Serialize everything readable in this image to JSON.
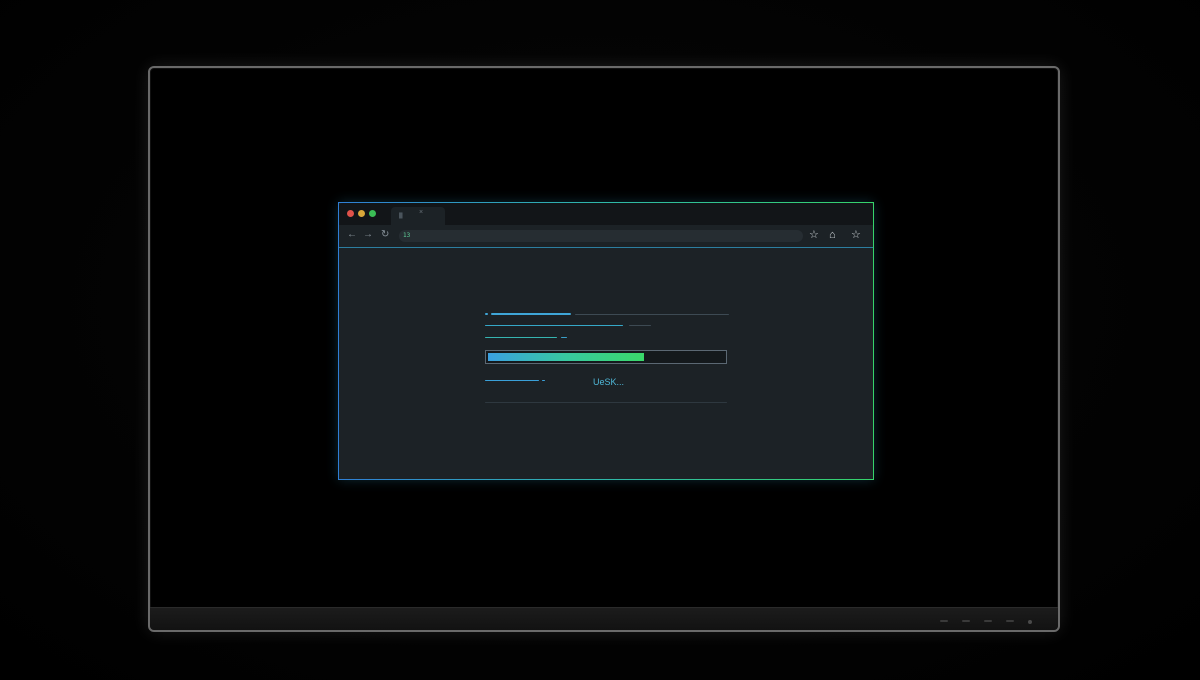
{
  "browser": {
    "tab_label": "█",
    "tab_close": "×",
    "address_badge": "13",
    "nav": {
      "back_icon": "←",
      "forward_icon": "→",
      "reload_icon": "↻"
    },
    "toolbar_right": {
      "star_icon": "☆",
      "extension_icon": "⌂",
      "profile_icon": "☆"
    }
  },
  "loader": {
    "progress": 0.66,
    "status_text": "UeSK..."
  },
  "colors": {
    "accent_blue": "#3aa0e0",
    "accent_green": "#3ad86a",
    "border_blue": "#2f7fd6",
    "border_green": "#36d36a"
  }
}
